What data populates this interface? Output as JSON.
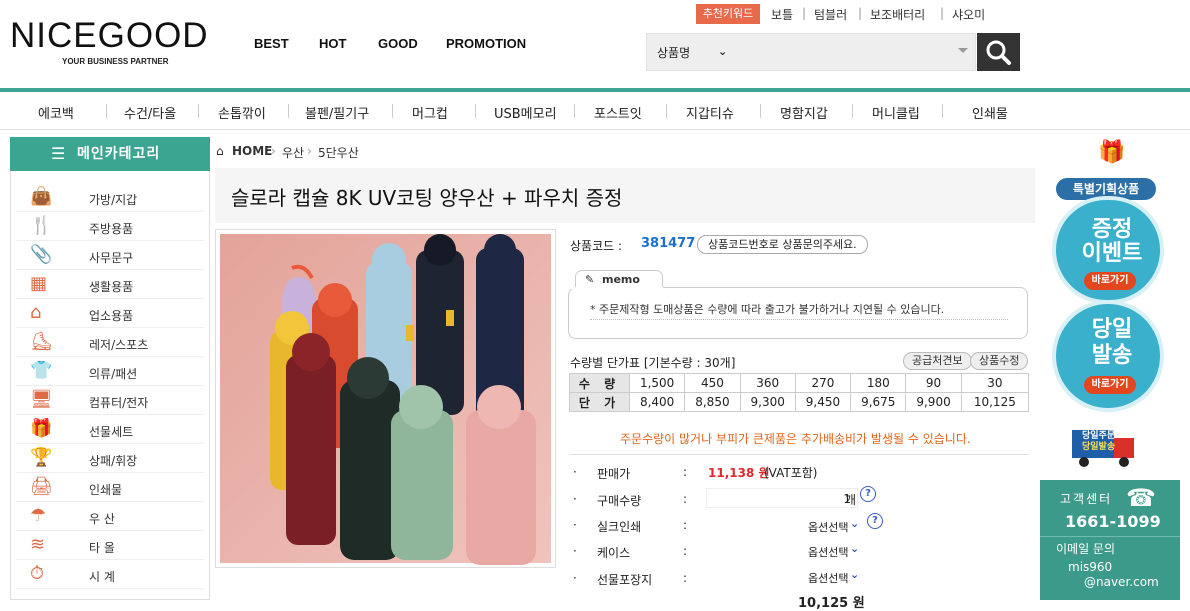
{
  "header": {
    "logo": "NICEGOOD",
    "tagline": "YOUR BUSINESS PARTNER",
    "nav": [
      "BEST",
      "HOT",
      "GOOD",
      "PROMOTION"
    ],
    "recommend_label": "추천키워드",
    "keywords": [
      "보틀",
      "텀블러",
      "보조배터리",
      "샤오미"
    ],
    "search_category": "상품명"
  },
  "categories": [
    "에코백",
    "수건/타올",
    "손톱깎이",
    "볼펜/필기구",
    "머그컵",
    "USB메모리",
    "포스트잇",
    "지갑티슈",
    "명함지갑",
    "머니클립",
    "인쇄물"
  ],
  "sidebar": {
    "title": "메인카테고리",
    "items": [
      "가방/지갑",
      "주방용품",
      "사무문구",
      "생활용품",
      "업소용품",
      "레저/스포츠",
      "의류/패션",
      "컴퓨터/전자",
      "선물세트",
      "상패/휘장",
      "인쇄물",
      "우 산",
      "타 올",
      "시 계"
    ]
  },
  "breadcrumb": {
    "home": "HOME",
    "level1": "우산",
    "level2": "5단우산"
  },
  "product": {
    "title": "슬로라 캡슐 8K UV코팅 양우산 + 파우치 증정",
    "code_label": "상품코드 :",
    "code": "381477",
    "code_note": "상품코드번호로 상품문의주세요.",
    "memo_label": "memo",
    "memo_text": "* 주문제작형 도매상품은 수량에 따라 출고가 불가하거나 지연될 수 있습니다.",
    "price_table_title": "수량별 단가표 [기본수량 : 30개]",
    "btn_estimate": "공급처견보",
    "btn_qty": "상품수정",
    "qty_label": "수 량",
    "price_label": "단 가",
    "quantities": [
      "1,500",
      "450",
      "360",
      "270",
      "180",
      "90",
      "30"
    ],
    "prices": [
      "8,400",
      "8,850",
      "9,300",
      "9,450",
      "9,675",
      "9,900",
      "10,125"
    ],
    "notice": "주문수량이 많거나 부피가 큰제품은 추가배송비가 발생될 수 있습니다.",
    "options": [
      {
        "label": "판매가",
        "value": "11,138 원",
        "suffix": "(VAT포함)"
      },
      {
        "label": "구매수량",
        "value": "1",
        "suffix": "개"
      },
      {
        "label": "실크인쇄",
        "value": "옵션선택"
      },
      {
        "label": "케이스",
        "value": "옵션선택"
      },
      {
        "label": "선물포장지",
        "value": "옵션선택"
      }
    ],
    "partial_total": "10,125 원"
  },
  "right": {
    "event_badge": "특별기획상품",
    "event_title1": "증정",
    "event_title2": "이벤트",
    "event_btn": "바로가기",
    "delivery_title1": "당일",
    "delivery_title2": "발송",
    "delivery_btn": "바로가기",
    "truck_text1": "당일주문",
    "truck_text2": "당일발송",
    "cs_title": "고객센터",
    "cs_phone": "1661-1099",
    "cs_email_label": "이메일 문의",
    "cs_email1": "mis960",
    "cs_email2": "@naver.com"
  },
  "colors": {
    "accent": "#3ba592",
    "price_red": "#e0282d",
    "notice_orange": "#e0651e",
    "code_blue": "#1a6fd1"
  }
}
